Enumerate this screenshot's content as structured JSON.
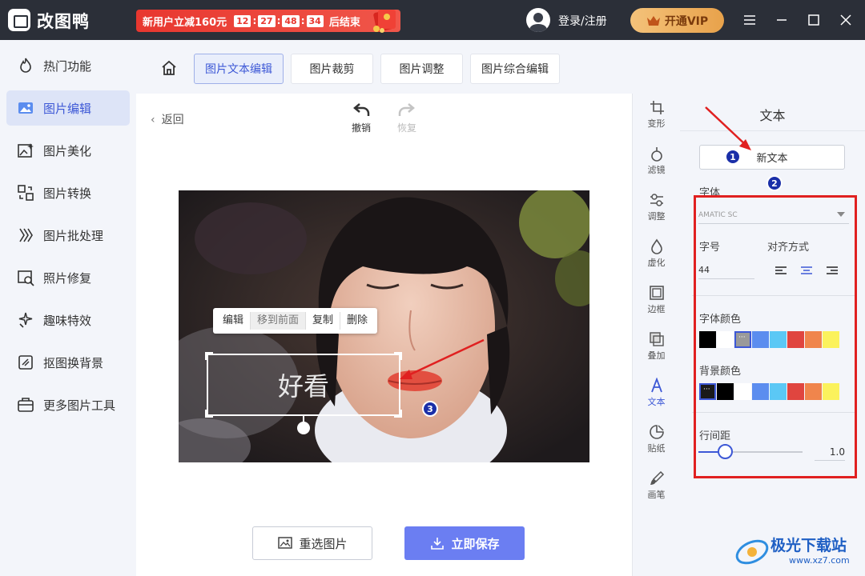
{
  "app": {
    "name": "改图鸭"
  },
  "promo": {
    "text": "新用户立减160元",
    "hh": "12",
    "mm": "27",
    "ss": "48",
    "ms": "34",
    "suffix": "后结束"
  },
  "header": {
    "login_label": "登录/注册",
    "vip_label": "开通VIP"
  },
  "sidebar": {
    "items": [
      {
        "label": "热门功能",
        "icon": "fire-icon"
      },
      {
        "label": "图片编辑",
        "icon": "image-edit-icon",
        "active": true
      },
      {
        "label": "图片美化",
        "icon": "image-beautify-icon"
      },
      {
        "label": "图片转换",
        "icon": "convert-icon"
      },
      {
        "label": "图片批处理",
        "icon": "batch-icon"
      },
      {
        "label": "照片修复",
        "icon": "repair-icon"
      },
      {
        "label": "趣味特效",
        "icon": "sparkle-icon"
      },
      {
        "label": "抠图换背景",
        "icon": "cutout-icon"
      },
      {
        "label": "更多图片工具",
        "icon": "toolbox-icon"
      }
    ]
  },
  "tabs": [
    {
      "label": "图片文本编辑",
      "active": true
    },
    {
      "label": "图片裁剪"
    },
    {
      "label": "图片调整"
    },
    {
      "label": "图片综合编辑"
    }
  ],
  "canvas": {
    "back_label": "返回",
    "undo_label": "撤销",
    "redo_label": "恢复",
    "context_menu": [
      "编辑",
      "移到前面",
      "复制",
      "删除"
    ],
    "text_box_value": "好看",
    "reselect_label": "重选图片",
    "save_label": "立即保存"
  },
  "tools": [
    {
      "label": "变形",
      "icon": "transform-icon"
    },
    {
      "label": "滤镜",
      "icon": "filter-icon"
    },
    {
      "label": "调整",
      "icon": "adjust-icon"
    },
    {
      "label": "虚化",
      "icon": "blur-icon"
    },
    {
      "label": "边框",
      "icon": "border-icon"
    },
    {
      "label": "叠加",
      "icon": "overlay-icon"
    },
    {
      "label": "文本",
      "icon": "text-icon",
      "active": true
    },
    {
      "label": "贴纸",
      "icon": "sticker-icon"
    },
    {
      "label": "画笔",
      "icon": "brush-icon"
    }
  ],
  "panel": {
    "title": "文本",
    "new_text_label": "新文本",
    "font_label": "字体",
    "font_value": "AMATIC SC",
    "size_label": "字号",
    "size_value": "44",
    "align_label": "对齐方式",
    "font_color_label": "字体颜色",
    "font_colors": [
      "#000000",
      "#ffffff",
      "#9a9a9a",
      "#5b8def",
      "#5bc8f5",
      "#e0453f",
      "#f0854c",
      "#fbf25c"
    ],
    "bg_color_label": "背景颜色",
    "bg_colors": [
      "#1a1a1a",
      "#000000",
      "#ffffff",
      "#5b8def",
      "#5bc8f5",
      "#e0453f",
      "#f0854c",
      "#fbf25c"
    ],
    "line_height_label": "行间距",
    "line_height_value": "1.0",
    "line_height_fraction": 0.25
  },
  "annotations": {
    "badge1": "1",
    "badge2": "2",
    "badge3": "3",
    "accent": "#e02020",
    "badge_color": "#1a2fa8"
  },
  "watermark": {
    "text": "极光下载站",
    "url": "www.xz7.com"
  }
}
